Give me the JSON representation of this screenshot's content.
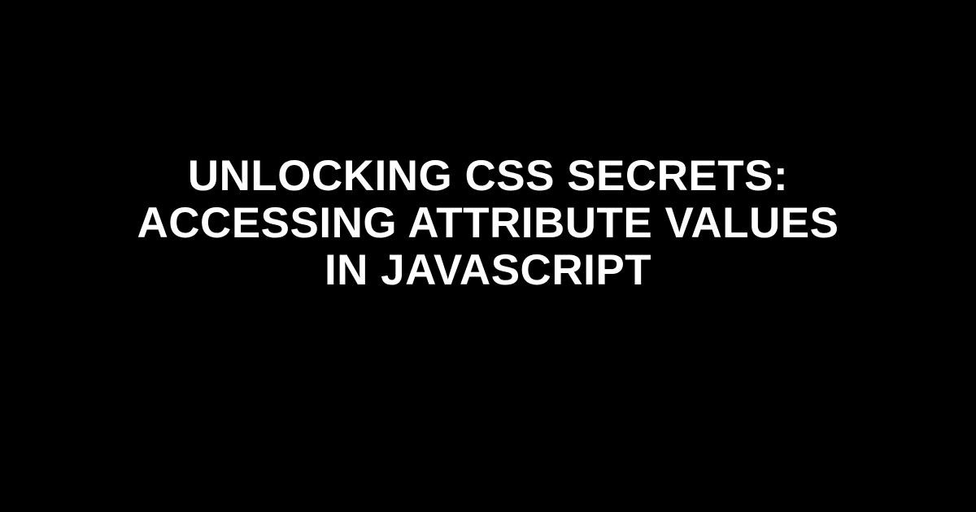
{
  "title": "Unlocking CSS Secrets: Accessing Attribute Values in JavaScript"
}
